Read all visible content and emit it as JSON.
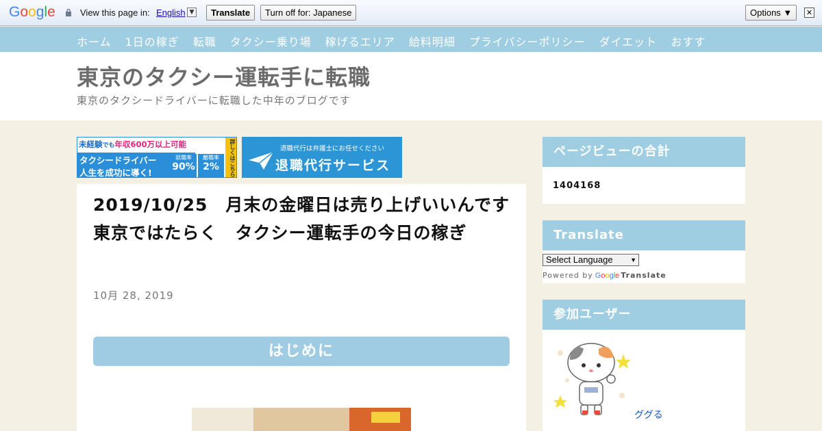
{
  "translate_bar": {
    "logo": "Google",
    "prompt": "View this page in:",
    "language": "English",
    "translate_button": "Translate",
    "turn_off_button": "Turn off for: Japanese",
    "options_button": "Options ▼",
    "close_glyph": "✕",
    "dropdown_glyph": "▼"
  },
  "nav": {
    "items": [
      "ホーム",
      "1日の稼ぎ",
      "転職",
      "タクシー乗り場",
      "稼げるエリア",
      "給料明細",
      "プライバシーポリシー",
      "ダイエット",
      "おすす"
    ]
  },
  "header": {
    "title": "東京のタクシー運転手に転職",
    "description": "東京のタクシードライバーに転職した中年のブログです"
  },
  "banner1": {
    "top_prefix": "未経験",
    "top_mid": "でも",
    "top_highlight": "年収600万以上可能",
    "line1": "タクシードライバー",
    "line2": "人生を成功に導く!",
    "stat1_label": "就職率",
    "stat1_value": "90%",
    "stat2_label": "離職率",
    "stat2_value": "2%",
    "side": "詳しくはこちら"
  },
  "banner2": {
    "small": "退職代行は弁護士にお任せください",
    "big": "退職代行サービス"
  },
  "post": {
    "title": "2019/10/25　月末の金曜日は売り上げいいんです　東京ではたらく　タクシー運転手の今日の稼ぎ",
    "date": "10月 28, 2019",
    "heading": "はじめに"
  },
  "sidebar": {
    "pageviews": {
      "title": "ページビューの合計",
      "count": "1404168"
    },
    "translate": {
      "title": "Translate",
      "select_label": "Select Language",
      "select_arrow": "▼",
      "powered_by": "Powered by",
      "google": "Google",
      "translate_word": "Translate"
    },
    "users": {
      "title": "参加ユーザー",
      "user_name": "ググる"
    }
  },
  "colors": {
    "nav_bg": "#9fcde2",
    "page_bg": "#f4f0e4",
    "banner_blue": "#2a8ed8"
  }
}
